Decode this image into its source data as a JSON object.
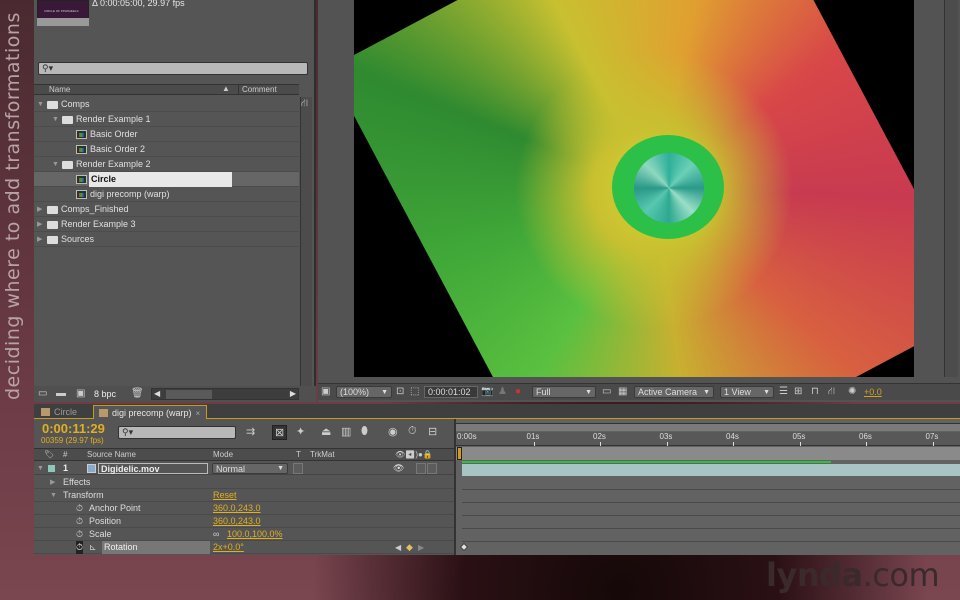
{
  "side_caption": "deciding where to add transformations",
  "watermark": {
    "bold": "lynda",
    "rest": ".com"
  },
  "project_panel": {
    "thumbnail_caption": "CIRCLE OF PINWHEELS",
    "info": "Δ 0:00:05:00, 29.97 fps",
    "search": {
      "placeholder": "",
      "icon": "search-icon"
    },
    "columns": {
      "name": "Name",
      "sort_icon": "▲",
      "comment": "Comment"
    },
    "tree": [
      {
        "type": "folder",
        "label": "Comps",
        "expanded": true,
        "depth": 0
      },
      {
        "type": "folder",
        "label": "Render Example 1",
        "expanded": true,
        "depth": 1
      },
      {
        "type": "comp",
        "label": "Basic Order",
        "depth": 2
      },
      {
        "type": "comp",
        "label": "Basic Order 2",
        "depth": 2
      },
      {
        "type": "folder",
        "label": "Render Example 2",
        "expanded": true,
        "depth": 1
      },
      {
        "type": "comp",
        "label": "Circle",
        "depth": 2,
        "selected": true,
        "editing": true
      },
      {
        "type": "comp",
        "label": "digi precomp (warp)",
        "depth": 2
      },
      {
        "type": "folder",
        "label": "Comps_Finished",
        "expanded": false,
        "depth": 0
      },
      {
        "type": "folder",
        "label": "Render Example 3",
        "expanded": false,
        "depth": 0
      },
      {
        "type": "folder",
        "label": "Sources",
        "expanded": false,
        "depth": 0
      }
    ],
    "footer": {
      "bit_depth": "8 bpc"
    }
  },
  "viewer": {
    "toolbar": {
      "magnification": "(100%)",
      "timecode": "0:00:01:02",
      "resolution": "Full",
      "camera": "Active Camera",
      "view_layout": "1 View",
      "exposure": "+0.0"
    }
  },
  "timeline": {
    "tabs": [
      {
        "label": "Circle",
        "active": false
      },
      {
        "label": "digi precomp (warp)",
        "active": true,
        "close": "×"
      }
    ],
    "current_time": "0:00:11:29",
    "frame_info": "00359 (29.97 fps)",
    "columns": {
      "num": "#",
      "source_name": "Source Name",
      "mode": "Mode",
      "t": "T",
      "trkmat": "TrkMat"
    },
    "layer": {
      "number": "1",
      "name": "Digidelic.mov",
      "mode": "Normal"
    },
    "properties": {
      "effects": "Effects",
      "transform": "Transform",
      "reset": "Reset",
      "anchor_point": {
        "label": "Anchor Point",
        "value": "360.0,243.0"
      },
      "position": {
        "label": "Position",
        "value": "360.0,243.0"
      },
      "scale": {
        "label": "Scale",
        "value": "100.0,100.0%"
      },
      "rotation": {
        "label": "Rotation",
        "value": "2x+0.0°"
      }
    },
    "ruler_ticks": [
      "0:00s",
      "01s",
      "02s",
      "03s",
      "04s",
      "05s",
      "06s",
      "07s"
    ],
    "render_progress": 0.74
  }
}
